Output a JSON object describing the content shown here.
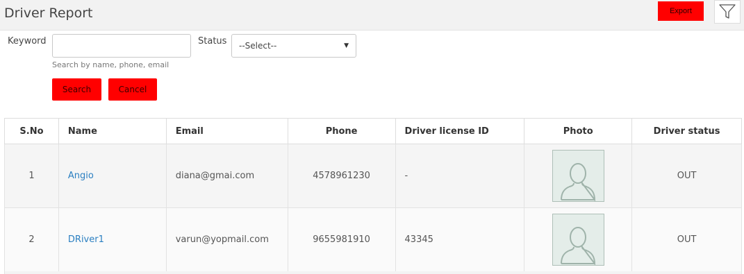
{
  "header": {
    "title": "Driver Report",
    "export_label": "Export",
    "filter_icon": "filter-funnel-icon"
  },
  "filters": {
    "keyword_label": "Keyword",
    "keyword_value": "",
    "keyword_placeholder": "",
    "keyword_hint": "Search by name, phone, email",
    "status_label": "Status",
    "status_selected": "--Select--",
    "search_label": "Search",
    "cancel_label": "Cancel"
  },
  "table": {
    "columns": [
      "S.No",
      "Name",
      "Email",
      "Phone",
      "Driver license ID",
      "Photo",
      "Driver status"
    ],
    "rows": [
      {
        "sno": "1",
        "name": "Angio",
        "email": "diana@gmai.com",
        "phone": "4578961230",
        "license": "-",
        "photo_icon": "user-avatar-placeholder-icon",
        "status": "OUT"
      },
      {
        "sno": "2",
        "name": "DRiver1",
        "email": "varun@yopmail.com",
        "phone": "9655981910",
        "license": "43345",
        "photo_icon": "user-avatar-placeholder-icon",
        "status": "OUT"
      }
    ]
  },
  "colors": {
    "accent_button": "#ff0000",
    "link": "#2a7fc1",
    "header_bar": "#f2f2f2"
  }
}
